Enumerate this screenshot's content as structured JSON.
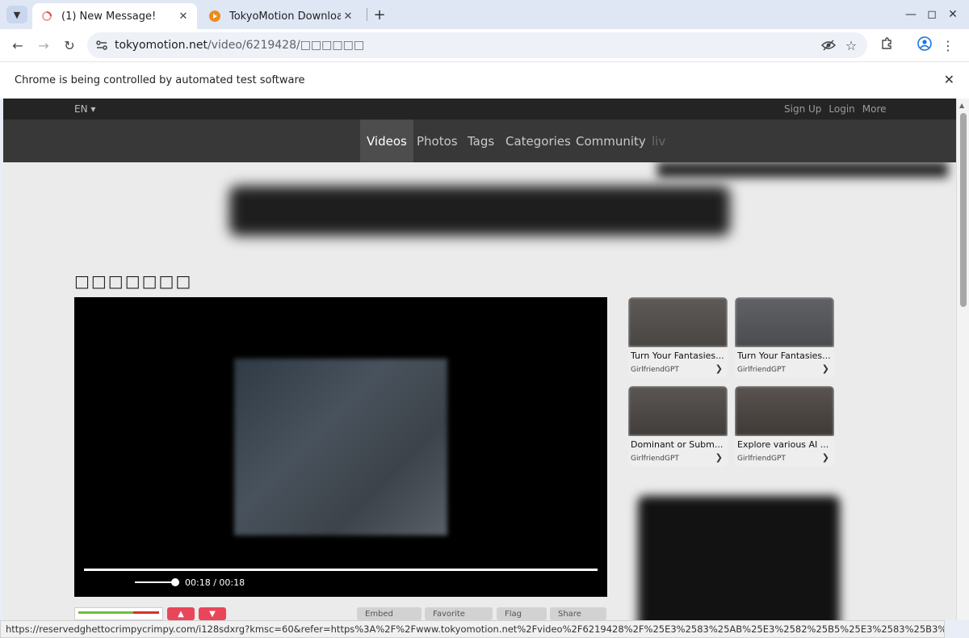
{
  "browser": {
    "tabs": [
      {
        "title": "(1) New Message!",
        "active": true
      },
      {
        "title": "TokyoMotion Downloader",
        "active": false
      }
    ],
    "address": {
      "host": "tokyomotion.net",
      "path": "/video/6219428/□□□□□□"
    },
    "infobar": "Chrome is being controlled by automated test software",
    "status_url": "https://reservedghettocrimpycrimpy.com/i128sdxrg?kmsc=60&refer=https%3A%2F%2Fwww.tokyomotion.net%2Fvideo%2F6219428%2F%25E3%2583%25AB%25E3%2582%25B5%25E3%2583%25B3%..."
  },
  "site": {
    "lang": "EN",
    "toplinks": [
      "Sign Up",
      "Login",
      "More"
    ],
    "nav": [
      "Videos",
      "Photos",
      "Tags",
      "Categories",
      "Community",
      "liv"
    ]
  },
  "video": {
    "title": "□□□□□□□",
    "time": "00:18 / 00:18"
  },
  "actions": {
    "embed": "Embed",
    "favorite": "Favorite",
    "flag": "Flag",
    "share": "Share"
  },
  "recommended": [
    {
      "title": "Turn Your Fantasies...",
      "source": "GirlfriendGPT"
    },
    {
      "title": "Turn Your Fantasies...",
      "source": "GirlfriendGPT"
    },
    {
      "title": "Dominant or Subm...",
      "source": "GirlfriendGPT"
    },
    {
      "title": "Explore various AI ...",
      "source": "GirlfriendGPT"
    }
  ],
  "icons": {
    "tab_menu": "chevron-down-icon",
    "back": "arrow-left-icon",
    "forward": "arrow-right-icon",
    "reload": "reload-icon",
    "site_info": "tune-icon",
    "eye_off": "eye-off-icon",
    "bookmark": "star-icon",
    "extensions": "puzzle-icon",
    "profile": "profile-icon",
    "menu": "kebab-menu-icon"
  },
  "colors": {
    "tabstrip": "#dfe7f5",
    "topbar": "#242424",
    "navbar": "#383838",
    "vote": "#e9465a"
  }
}
